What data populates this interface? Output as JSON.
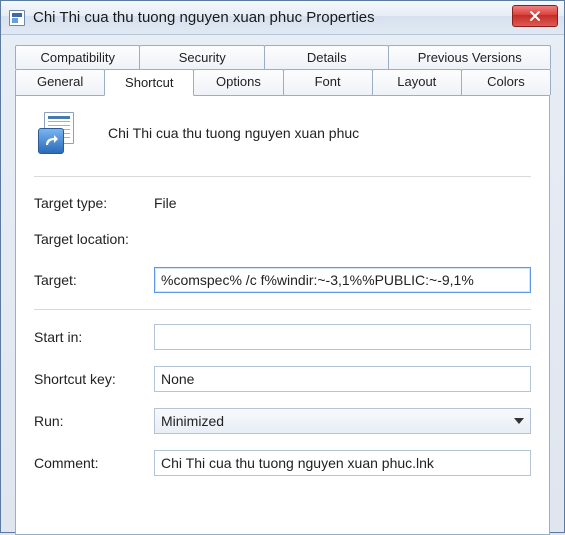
{
  "window": {
    "title": "Chi Thi cua thu tuong nguyen xuan phuc Properties"
  },
  "tabs": {
    "row1": [
      "Compatibility",
      "Security",
      "Details",
      "Previous Versions"
    ],
    "row2": [
      "General",
      "Shortcut",
      "Options",
      "Font",
      "Layout",
      "Colors"
    ],
    "active": "Shortcut"
  },
  "header": {
    "file_title": "Chi Thi cua thu tuong nguyen xuan phuc"
  },
  "labels": {
    "target_type": "Target type:",
    "target_location": "Target location:",
    "target": "Target:",
    "start_in": "Start in:",
    "shortcut_key": "Shortcut key:",
    "run": "Run:",
    "comment": "Comment:"
  },
  "values": {
    "target_type": "File",
    "target_location": "",
    "target": "%comspec% /c f%windir:~-3,1%%PUBLIC:~-9,1%",
    "start_in": "",
    "shortcut_key": "None",
    "run": "Minimized",
    "comment": "Chi Thi cua thu tuong nguyen xuan phuc.lnk"
  }
}
